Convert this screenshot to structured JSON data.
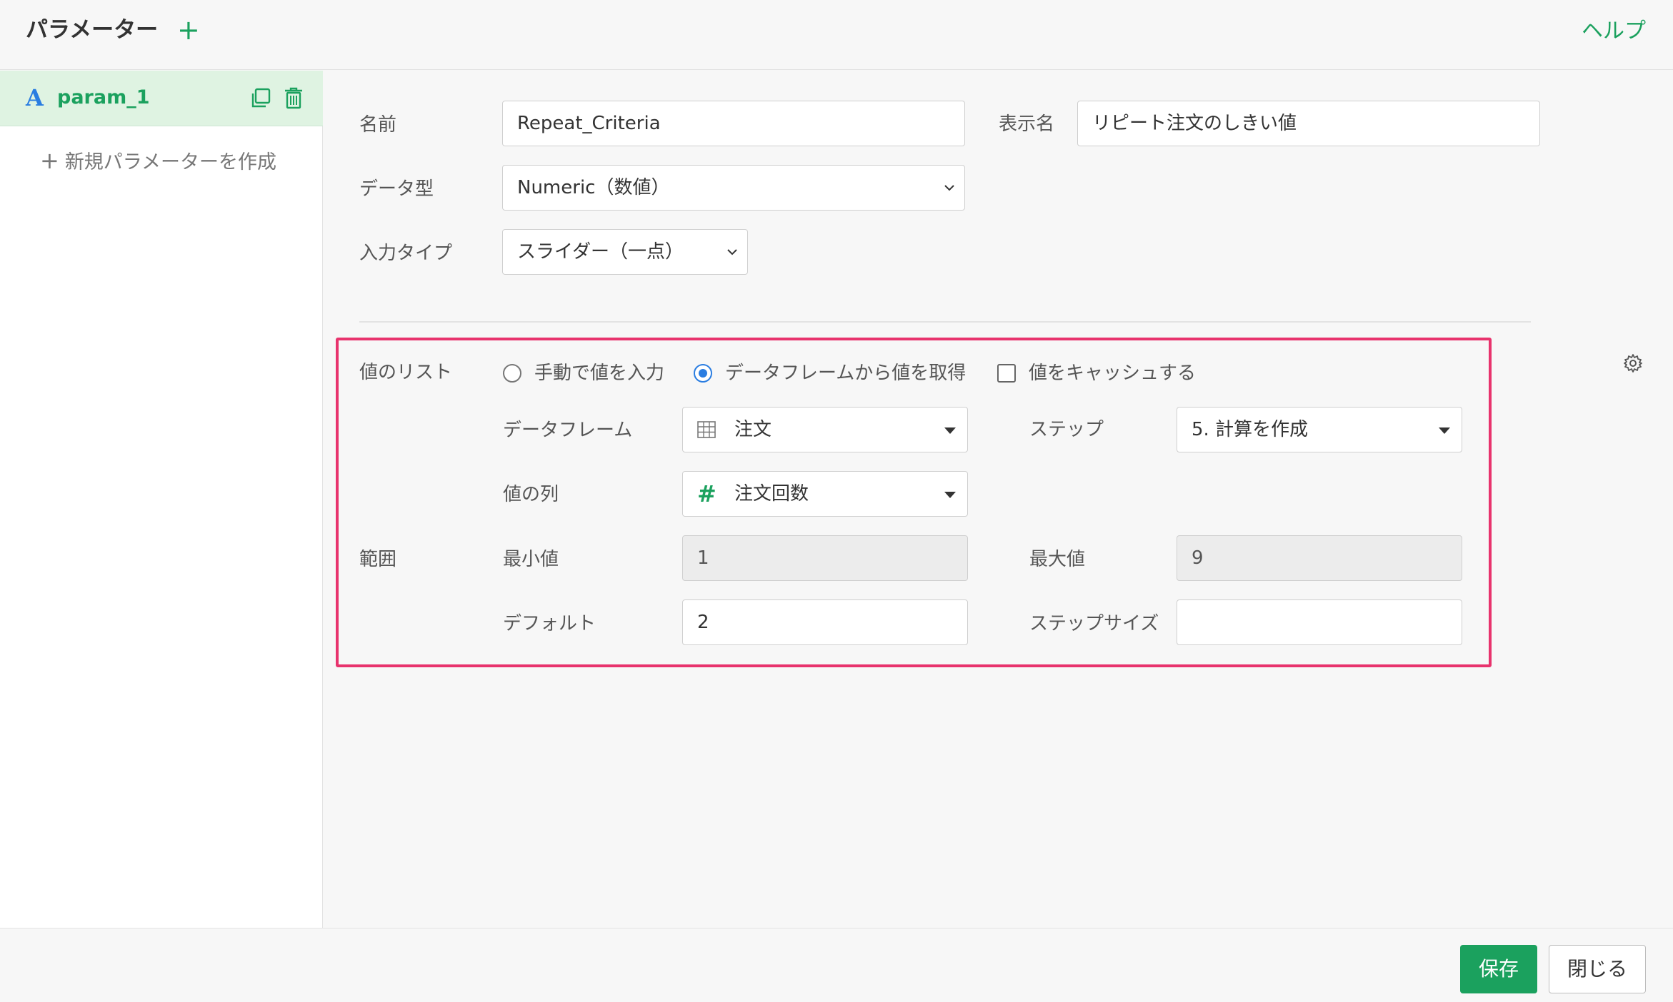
{
  "header": {
    "title": "パラメーター",
    "add_icon": "plus-icon",
    "help_label": "ヘルプ"
  },
  "sidebar": {
    "params": [
      {
        "type_glyph": "A",
        "name": "param_1"
      }
    ],
    "new_param_label": "新規パラメーターを作成"
  },
  "form": {
    "name_label": "名前",
    "name_value": "Repeat_Criteria",
    "display_name_label": "表示名",
    "display_name_value": "リピート注文のしきい値",
    "data_type_label": "データ型",
    "data_type_value": "Numeric（数値）",
    "input_type_label": "入力タイプ",
    "input_type_value": "スライダー（一点）"
  },
  "values": {
    "section_label": "値のリスト",
    "radio_manual_label": "手動で値を入力",
    "radio_dataframe_label": "データフレームから値を取得",
    "selected_source": "dataframe",
    "cache_label": "値をキャッシュする",
    "cache_checked": false,
    "dataframe_label": "データフレーム",
    "dataframe_value": "注文",
    "step_label": "ステップ",
    "step_value": "5. 計算を作成",
    "column_label": "値の列",
    "column_value": "注文回数"
  },
  "range": {
    "section_label": "範囲",
    "min_label": "最小値",
    "min_value": "1",
    "max_label": "最大値",
    "max_value": "9",
    "default_label": "デフォルト",
    "default_value": "2",
    "step_size_label": "ステップサイズ",
    "step_size_value": ""
  },
  "footer": {
    "save_label": "保存",
    "close_label": "閉じる"
  },
  "colors": {
    "accent_green": "#1ba15e",
    "accent_blue": "#2a7de1",
    "highlight_pink": "#e8336d"
  }
}
